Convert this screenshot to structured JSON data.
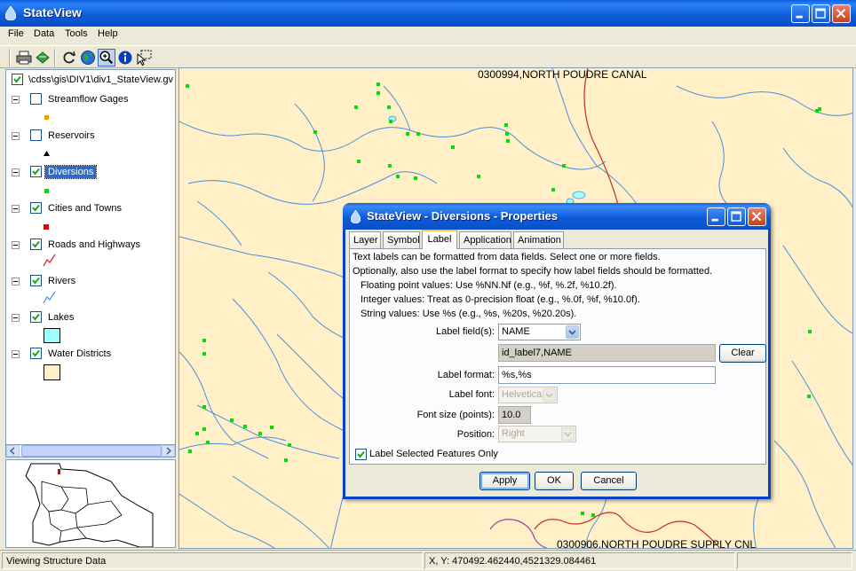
{
  "window": {
    "title": "StateView"
  },
  "menu": {
    "items": [
      "File",
      "Data",
      "Tools",
      "Help"
    ]
  },
  "toolbar": {
    "buttons": [
      "print-icon",
      "export-icon",
      "refresh-icon",
      "globe-icon",
      "zoom-icon",
      "info-icon",
      "select-icon"
    ]
  },
  "legend": {
    "root": "\\cdss\\gis\\DIV1\\div1_StateView.gv",
    "layers": [
      {
        "label": "Streamflow Gages",
        "checked": false,
        "symbol": "orange-square"
      },
      {
        "label": "Reservoirs",
        "checked": false,
        "symbol": "black-triangle"
      },
      {
        "label": "Diversions",
        "checked": true,
        "symbol": "green-square",
        "selected": true
      },
      {
        "label": "Cities and Towns",
        "checked": true,
        "symbol": "red-square"
      },
      {
        "label": "Roads and Highways",
        "checked": true,
        "symbol": "red-line"
      },
      {
        "label": "Rivers",
        "checked": true,
        "symbol": "blue-line"
      },
      {
        "label": "Lakes",
        "checked": true,
        "symbol": "cyan-box"
      },
      {
        "label": "Water Districts",
        "checked": true,
        "symbol": "tan-box"
      }
    ]
  },
  "map": {
    "labels": [
      "0300994,NORTH POUDRE CANAL",
      "0300906,NORTH POUDRE SUPPLY CNL"
    ]
  },
  "status": {
    "message": "Viewing Structure Data",
    "coords": "X, Y:  470492.462440,4521329.084461"
  },
  "dialog": {
    "title": "StateView - Diversions - Properties",
    "tabs": [
      "Layer",
      "Symbol",
      "Label",
      "Application",
      "Animation"
    ],
    "active_tab": "Label",
    "help": [
      "Text labels can  be formatted from data fields.  Select one or more fields.",
      "Optionally, also use  the label format to specify how label fields should be formatted.",
      "Floating point values:  Use %NN.Nf (e.g., %f, %.2f, %10.2f).",
      "Integer values:  Treat as 0-precision float (e.g., %.0f, %f, %10.0f).",
      "String values:  Use %s (e.g., %s, %20s, %20.20s)."
    ],
    "label_fields_label": "Label field(s):",
    "label_fields_value": "NAME",
    "selected_fields": "id_label7,NAME",
    "clear_label": "Clear",
    "label_format_label": "Label format:",
    "label_format_value": "%s,%s",
    "label_font_label": "Label font:",
    "label_font_value": "Helvetica",
    "font_size_label": "Font size (points):",
    "font_size_value": "10.0",
    "position_label": "Position:",
    "position_value": "Right",
    "selected_only_label": "Label Selected Features Only",
    "selected_only_checked": true,
    "apply_label": "Apply",
    "ok_label": "OK",
    "cancel_label": "Cancel"
  },
  "colors": {
    "titlebar": "#0A5FE0",
    "map_background": "#FFF0C8",
    "river": "#4A8FE0",
    "diversion": "#00E000",
    "road": "#C03020",
    "lake": "#9FFFFF"
  }
}
